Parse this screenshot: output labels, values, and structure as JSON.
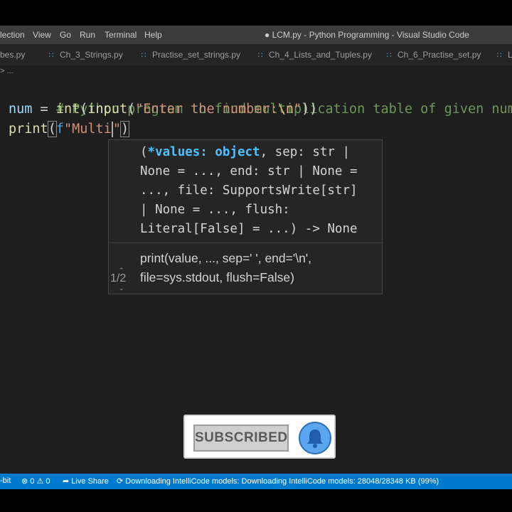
{
  "menubar": {
    "items": [
      "lection",
      "View",
      "Go",
      "Run",
      "Terminal",
      "Help"
    ],
    "title": "● LCM.py - Python Programming - Visual Studio Code"
  },
  "tabs": [
    {
      "label": "bes.py"
    },
    {
      "label": "Ch_3_Strings.py"
    },
    {
      "label": "Practise_set_strings.py"
    },
    {
      "label": "Ch_4_Lists_and_Tuples.py"
    },
    {
      "label": "Ch_6_Practise_set.py"
    },
    {
      "label": "L"
    }
  ],
  "breadcrumb": "> ...",
  "editor": {
    "line1": {
      "comment": "# Python program to find multiplication table of given number"
    },
    "line2": {
      "var": "num",
      "eq": " = ",
      "fn1": "int",
      "p1": "(",
      "fn2": "input",
      "p2": "(",
      "str": "\"Enter the number:",
      "esc": "\\n",
      "strend": "\"",
      "close": "))"
    },
    "line3": {
      "fn": "print",
      "open": "(",
      "fprefix": "f",
      "str": "\"Multi",
      "strend": "\"",
      "close": ")"
    }
  },
  "signature_help": {
    "line1_open": "(",
    "line1_active": "*values: object",
    "line1_rest": ", sep: str |",
    "line2": "None = ..., end: str | None =",
    "line3": "..., file: SupportsWrite[str]",
    "line4": "| None = ..., flush:",
    "line5": "Literal[False] = ...) -> None",
    "doc1": "print(value, ..., sep=' ', end='\\n',",
    "doc2": "file=sys.stdout, flush=False)",
    "counter": "1/2"
  },
  "statusbar": {
    "bit": "-bit",
    "problems": "⊗ 0 ⚠ 0",
    "live_share": "Live Share",
    "downloading": "Downloading IntelliCode models: Downloading IntelliCode models: 28048/28348 KB (99%)"
  },
  "overlay": {
    "subscribed_label": "SUBSCRIBED"
  },
  "colors": {
    "accent": "#007acc",
    "editor_bg": "#1e1e1e",
    "comment": "#6a9955",
    "string": "#ce9178",
    "function": "#dcdcaa",
    "variable": "#9cdcfe"
  }
}
